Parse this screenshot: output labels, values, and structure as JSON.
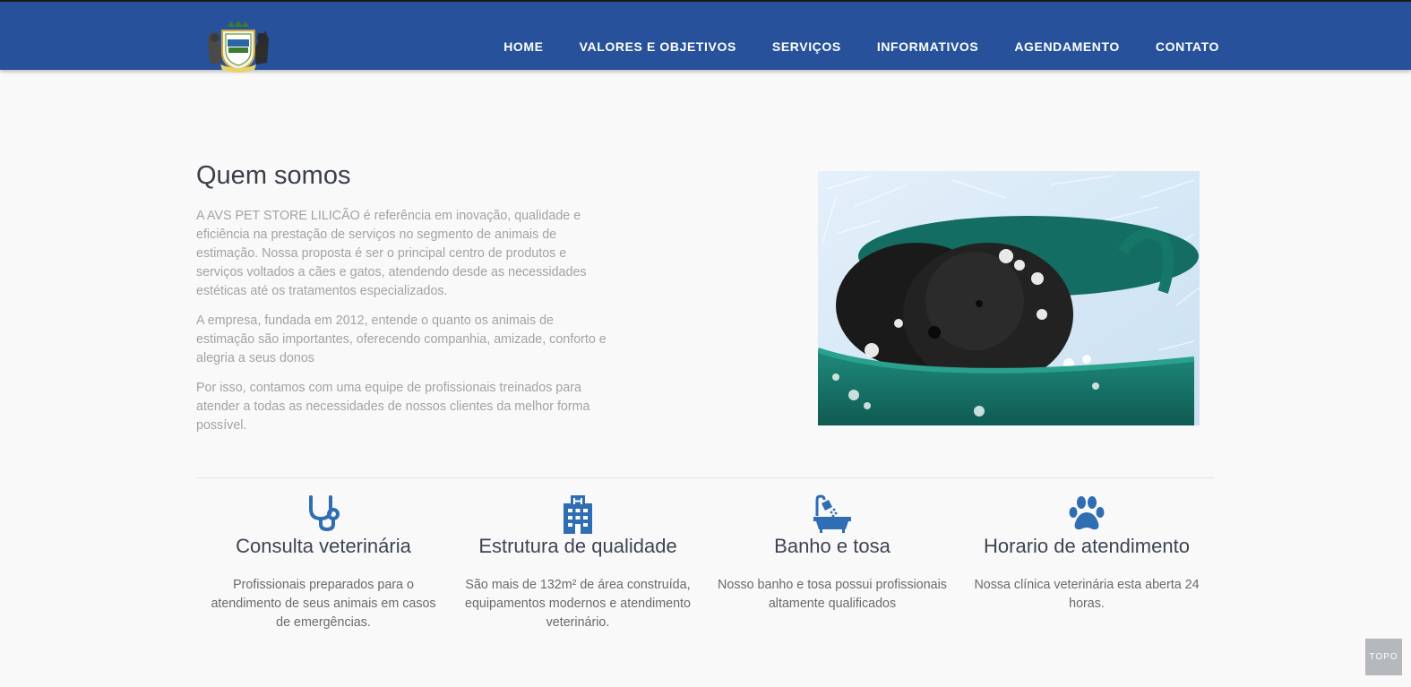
{
  "brand": {
    "logo_name": "pet-store-lilicao-logo",
    "logo_text": "Pet Store Lilicão"
  },
  "nav": {
    "items": [
      {
        "label": "HOME"
      },
      {
        "label": "VALORES E OBJETIVOS"
      },
      {
        "label": "SERVIÇOS"
      },
      {
        "label": "INFORMATIVOS"
      },
      {
        "label": "AGENDAMENTO"
      },
      {
        "label": "CONTATO"
      }
    ]
  },
  "about": {
    "title": "Quem somos",
    "paragraphs": [
      "A AVS PET STORE LILICÃO é referência em inovação, qualidade e eficiência na prestação de serviços no segmento de animais de estimação. Nossa proposta é ser o principal centro de produtos e serviços voltados a cães e gatos, atendendo desde as necessidades estéticas até os tratamentos especializados.",
      "A empresa, fundada em 2012, entende o quanto os animais de estimação são importantes, oferecendo companhia, amizade, conforto e alegria a seus donos",
      "Por isso, contamos com uma equipe de profissionais treinados para atender a todas as necessidades de nossos clientes da melhor forma possível."
    ],
    "image": "dog-in-bath-bucket-photo"
  },
  "features": [
    {
      "icon": "stethoscope-icon",
      "title": "Consulta veterinária",
      "text": "Profissionais preparados para o atendimento de seus animais em casos de emergências."
    },
    {
      "icon": "hospital-building-icon",
      "title": "Estrutura de qualidade",
      "text": "São mais de 132m² de área construída, equipamentos modernos e atendimento veterinário."
    },
    {
      "icon": "bathtub-shower-icon",
      "title": "Banho e tosa",
      "text": "Nosso banho e tosa possui profissionais altamente qualificados"
    },
    {
      "icon": "paw-print-icon",
      "title": "Horario de atendimento",
      "text": "Nossa clínica veterinária esta aberta 24 horas."
    }
  ],
  "topo_button": {
    "label": "TOPO"
  },
  "colors": {
    "navbar": "#27529b",
    "icon": "#2f6eb3",
    "background": "#f9f9f9"
  }
}
